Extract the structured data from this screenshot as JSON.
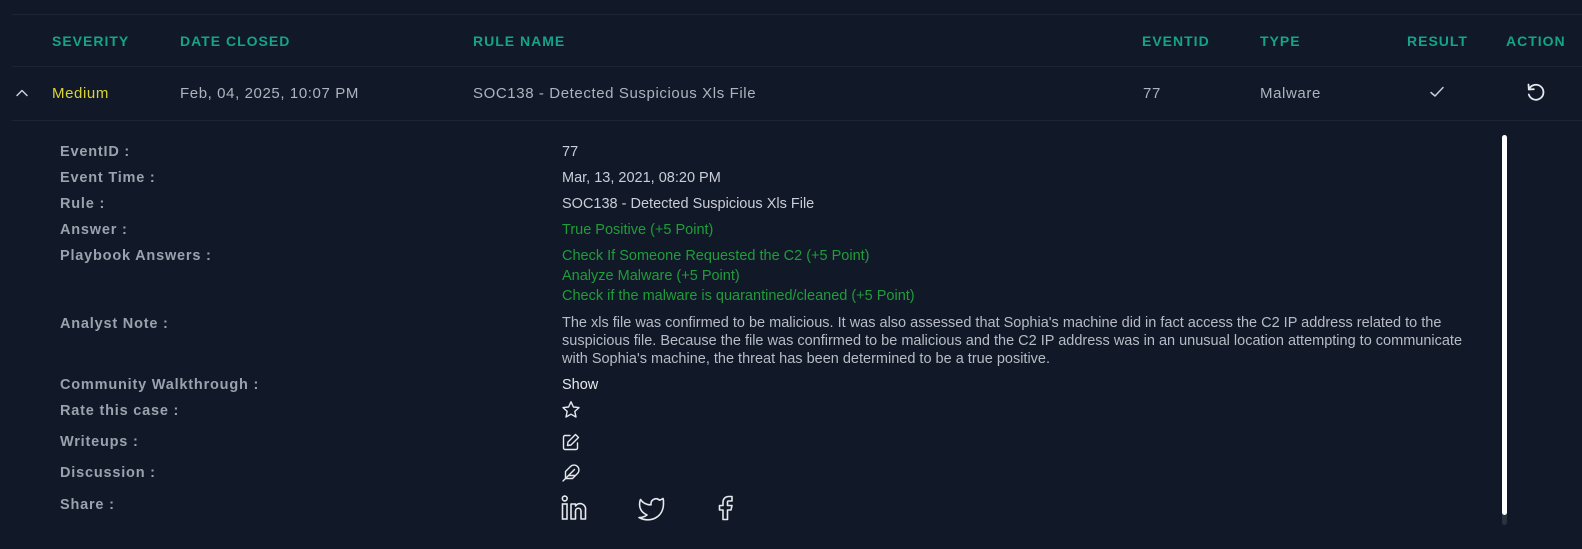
{
  "table": {
    "headers": {
      "severity": "SEVERITY",
      "date_closed": "DATE CLOSED",
      "rule_name": "RULE NAME",
      "eventid": "EVENTID",
      "type": "TYPE",
      "result": "RESULT",
      "action": "ACTION"
    },
    "row": {
      "severity": "Medium",
      "date_closed": "Feb, 04, 2025, 10:07 PM",
      "rule_name": "SOC138 - Detected Suspicious Xls File",
      "eventid": "77",
      "type": "Malware",
      "result_icon": "check-icon",
      "action_icon": "restart-icon"
    }
  },
  "details": {
    "eventid_label": "EventID :",
    "eventid_value": "77",
    "event_time_label": "Event Time :",
    "event_time_value": "Mar, 13, 2021, 08:20 PM",
    "rule_label": "Rule :",
    "rule_value": "SOC138 - Detected Suspicious Xls File",
    "answer_label": "Answer :",
    "answer_value": "True Positive (+5 Point)",
    "playbook_label": "Playbook Answers :",
    "playbook_answers": [
      "Check If Someone Requested the C2 (+5 Point)",
      "Analyze Malware (+5 Point)",
      "Check if the malware is quarantined/cleaned (+5 Point)"
    ],
    "analyst_note_label": "Analyst Note :",
    "analyst_note": "The xls file was confirmed to be malicious. It was also assessed that Sophia's machine did in fact access the C2 IP address related to the suspicious file. Because the file was confirmed to be malicious and the C2 IP address was in an unusual location attempting to communicate with Sophia's machine, the threat has been determined to be a true positive.",
    "community_label": "Community Walkthrough :",
    "community_value": "Show",
    "rate_label": "Rate this case :",
    "writeups_label": "Writeups :",
    "discussion_label": "Discussion :",
    "share_label": "Share :",
    "icons": {
      "rate": "star-icon",
      "writeups": "edit-icon",
      "discussion": "feather-icon",
      "share": [
        "linkedin-icon",
        "twitter-icon",
        "facebook-icon"
      ]
    }
  },
  "colors": {
    "background": "#111827",
    "header_accent": "#14a38b",
    "severity_medium": "#d8d438",
    "answer_green": "#1f9d3a"
  }
}
